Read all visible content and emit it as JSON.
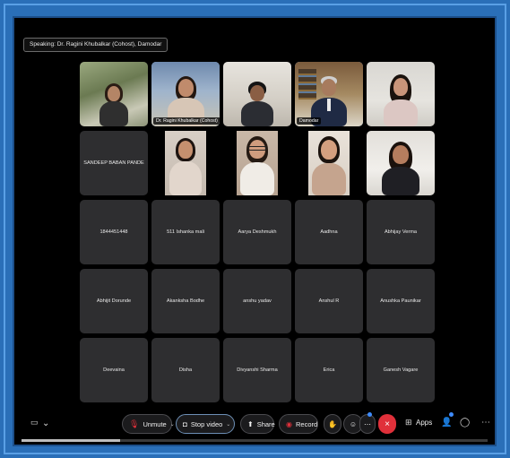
{
  "meeting": {
    "speaking_text": "Speaking: Dr. Ragini Khubalkar (Cohost), Damodar"
  },
  "video_tiles": [
    {
      "label": ""
    },
    {
      "label": "Dr. Ragini Khubalkar (Cohost)"
    },
    {
      "label": ""
    },
    {
      "label": "Damodar"
    },
    {
      "label": ""
    }
  ],
  "row2": {
    "name_tile": "SANDEEP BABAN PANDE"
  },
  "name_tiles": [
    "1844451448",
    "511 Ishanka mali",
    "Aarya Deshmukh",
    "Aadhna",
    "Abhijay Verma",
    "Abhijit Dorunde",
    "Akanksha Bodhe",
    "anshu yadav",
    "Anshul R",
    "Anushka Paunikar",
    "Deevaina",
    "Disha",
    "Divyanshi Sharma",
    "Erica",
    "Ganesh Vagare"
  ],
  "toolbar": {
    "unmute_label": "Unmute",
    "stop_video_label": "Stop video",
    "share_label": "Share",
    "record_label": "Record",
    "apps_label": "Apps",
    "end_label": "×",
    "caret": "⌄"
  },
  "icons": {
    "mic_muted": "mic-muted-icon",
    "video": "video-camera-icon",
    "share": "share-screen-icon",
    "record": "record-icon",
    "reactions": "raise-hand-icon",
    "emoji": "emoji-icon",
    "more": "more-options-icon",
    "apps": "apps-icon",
    "participants": "participants-icon",
    "chat": "chat-icon",
    "captions": "captions-icon"
  },
  "colors": {
    "frame_blue": "#2a6fb8",
    "end_red": "#e0303a",
    "tile_gray": "#2e2e30",
    "active_outline": "#7fb2e8"
  }
}
